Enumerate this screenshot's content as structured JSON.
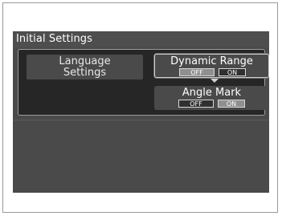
{
  "screen": {
    "title": "Initial Settings"
  },
  "menu": {
    "language_settings_line1": "Language",
    "language_settings_line2": "Settings"
  },
  "settings": {
    "dynamic_range": {
      "label": "Dynamic Range",
      "off_label": "OFF",
      "on_label": "ON",
      "selected": "OFF"
    },
    "angle_mark": {
      "label": "Angle Mark",
      "off_label": "OFF",
      "on_label": "ON",
      "selected": "ON"
    }
  },
  "colors": {
    "screen_background": "#4a4a4a",
    "panel_background": "#262626",
    "selected_toggle": "#8f8f8f",
    "text": "#ffffff"
  }
}
